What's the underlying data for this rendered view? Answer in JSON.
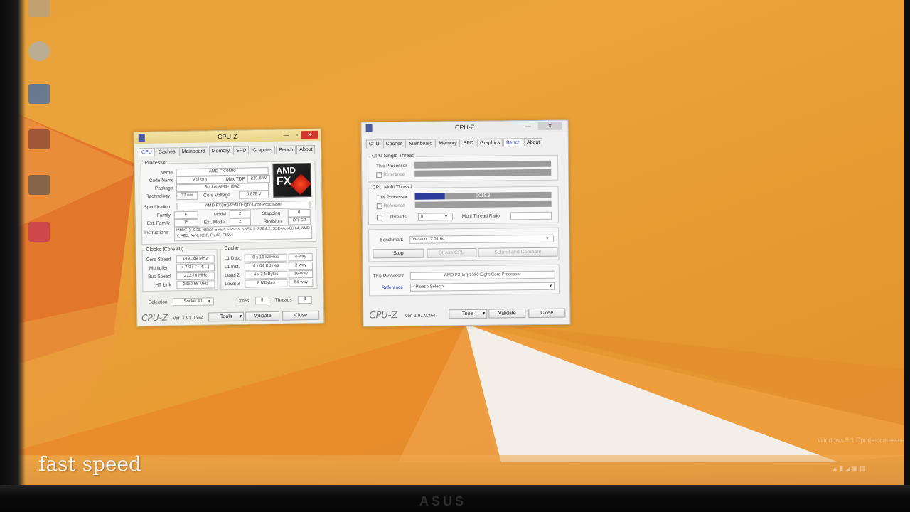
{
  "overlay": {
    "caption": "fast speed",
    "watermark": "Windows 8.1 Профессиональная",
    "bezel_brand": "ASUS"
  },
  "colors": {
    "wallpaper": "#e9a23a",
    "accent_blue": "#2b3c9a",
    "close_red": "#d0382b"
  },
  "left_window": {
    "title": "CPU-Z",
    "tabs": [
      "CPU",
      "Caches",
      "Mainboard",
      "Memory",
      "SPD",
      "Graphics",
      "Bench",
      "About"
    ],
    "active_tab": "CPU",
    "processor": {
      "section": "Processor",
      "name_label": "Name",
      "name": "AMD FX-9590",
      "codename_label": "Code Name",
      "codename": "Vishera",
      "maxtdp_label": "Max TDP",
      "maxtdp": "219.8 W",
      "package_label": "Package",
      "package": "Socket AM3+ (942)",
      "technology_label": "Technology",
      "technology": "32 nm",
      "voltage_label": "Core Voltage",
      "voltage": "0.876 V",
      "spec_label": "Specification",
      "spec": "AMD FX(tm)-9590 Eight-Core Processor",
      "family_label": "Family",
      "family": "F",
      "model_label": "Model",
      "model": "2",
      "stepping_label": "Stepping",
      "stepping": "0",
      "extfamily_label": "Ext. Family",
      "extfamily": "15",
      "extmodel_label": "Ext. Model",
      "extmodel": "2",
      "revision_label": "Revision",
      "revision": "OR-C0",
      "instructions_label": "Instructions",
      "instructions": "MMX(+), SSE, SSE2, SSE3, SSSE3, SSE4.1, SSE4.2, SSE4A, x86-64, AMD-V, AES, AVX, XOP, FMA3, FMA4",
      "logo_top": "AMD",
      "logo_main": "FX"
    },
    "clocks": {
      "section": "Clocks (Core #0)",
      "corespeed_label": "Core Speed",
      "corespeed": "1491.89 MHz",
      "multiplier_label": "Multiplier",
      "multiplier": "x 7.0 ( 7 - 4... )",
      "busspeed_label": "Bus Speed",
      "busspeed": "213.70 MHz",
      "htlink_label": "HT Link",
      "htlink": "2350.66 MHz"
    },
    "cache": {
      "section": "Cache",
      "rows": [
        {
          "label": "L1 Data",
          "size": "8 x 16 KBytes",
          "way": "4-way"
        },
        {
          "label": "L1 Inst.",
          "size": "4 x 64 KBytes",
          "way": "2-way"
        },
        {
          "label": "Level 2",
          "size": "4 x 2 MBytes",
          "way": "16-way"
        },
        {
          "label": "Level 3",
          "size": "8 MBytes",
          "way": "64-way"
        }
      ]
    },
    "footer": {
      "selection_label": "Selection",
      "selection": "Socket #1",
      "cores_label": "Cores",
      "cores": "8",
      "threads_label": "Threads",
      "threads": "8",
      "brand": "CPU-Z",
      "version": "Ver. 1.91.0.x64",
      "tools": "Tools",
      "validate": "Validate",
      "close": "Close"
    }
  },
  "right_window": {
    "title": "CPU-Z",
    "tabs": [
      "CPU",
      "Caches",
      "Mainboard",
      "Memory",
      "SPD",
      "Graphics",
      "Bench",
      "About"
    ],
    "active_tab": "Bench",
    "single": {
      "section": "CPU Single Thread",
      "this_label": "This Processor",
      "ref_label": "Reference",
      "progress": 0
    },
    "multi": {
      "section": "CPU Multi Thread",
      "this_label": "This Processor",
      "value": "2015.8",
      "progress": 0.22,
      "ref_label": "Reference",
      "threads_label": "Threads",
      "threads": "8",
      "ratio_label": "Multi Thread Ratio"
    },
    "benchmark": {
      "label": "Benchmark",
      "version": "Version 17.01.64",
      "stop": "Stop",
      "stress": "Stress CPU",
      "submit": "Submit and Compare"
    },
    "info": {
      "this_label": "This Processor",
      "this_value": "AMD FX(tm)-9590 Eight-Core Processor",
      "ref_label": "Reference",
      "ref_value": "<Please Select>"
    },
    "footer": {
      "brand": "CPU-Z",
      "version": "Ver. 1.91.0.x64",
      "tools": "Tools",
      "validate": "Validate",
      "close": "Close"
    }
  }
}
